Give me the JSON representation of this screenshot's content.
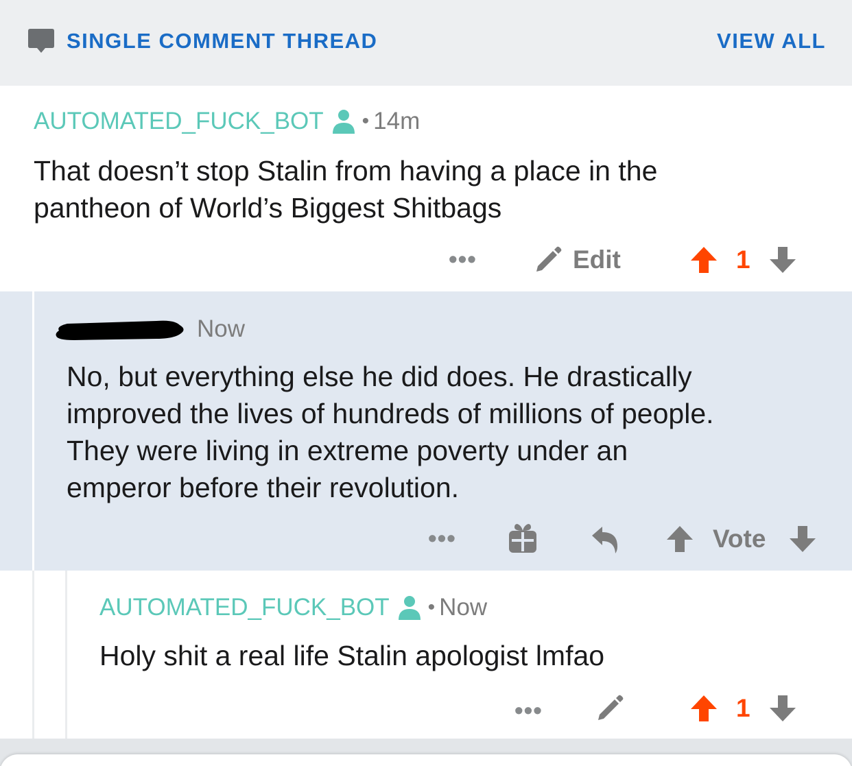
{
  "header": {
    "title": "SINGLE COMMENT THREAD",
    "view_all": "VIEW ALL"
  },
  "comments": [
    {
      "author": "AUTOMATED_FUCK_BOT",
      "separator": "•",
      "time": "14m",
      "body_lines": [
        "That doesn’t stop Stalin from having a place in the",
        "pantheon of World’s Biggest Shitbags"
      ],
      "actions": {
        "more": "•••",
        "edit": "Edit",
        "score": "1"
      }
    },
    {
      "author": "",
      "time": "Now",
      "body_lines": [
        "No, but everything else he did does. He drastically",
        "improved the lives of hundreds of millions of people.",
        "They were living in extreme poverty under an",
        "emperor before their revolution."
      ],
      "actions": {
        "more": "•••",
        "vote": "Vote"
      }
    },
    {
      "author": "AUTOMATED_FUCK_BOT",
      "separator": "•",
      "time": "Now",
      "body_lines": [
        "Holy shit a real life Stalin apologist lmfao"
      ],
      "actions": {
        "more": "•••",
        "score": "1"
      }
    }
  ],
  "icons": {
    "header": "chat-bubble-icon",
    "author_badge": "user-icon",
    "edit": "pencil-icon",
    "upvote": "arrow-up-icon",
    "downvote": "arrow-down-icon",
    "award": "gift-icon",
    "reply": "reply-icon"
  },
  "colors": {
    "link_blue": "#1a6cc6",
    "author_teal": "#5bc8b8",
    "upvote_orange": "#ff4500",
    "highlight_bg": "#e1e8f1",
    "muted_gray": "#7c7c7c"
  }
}
